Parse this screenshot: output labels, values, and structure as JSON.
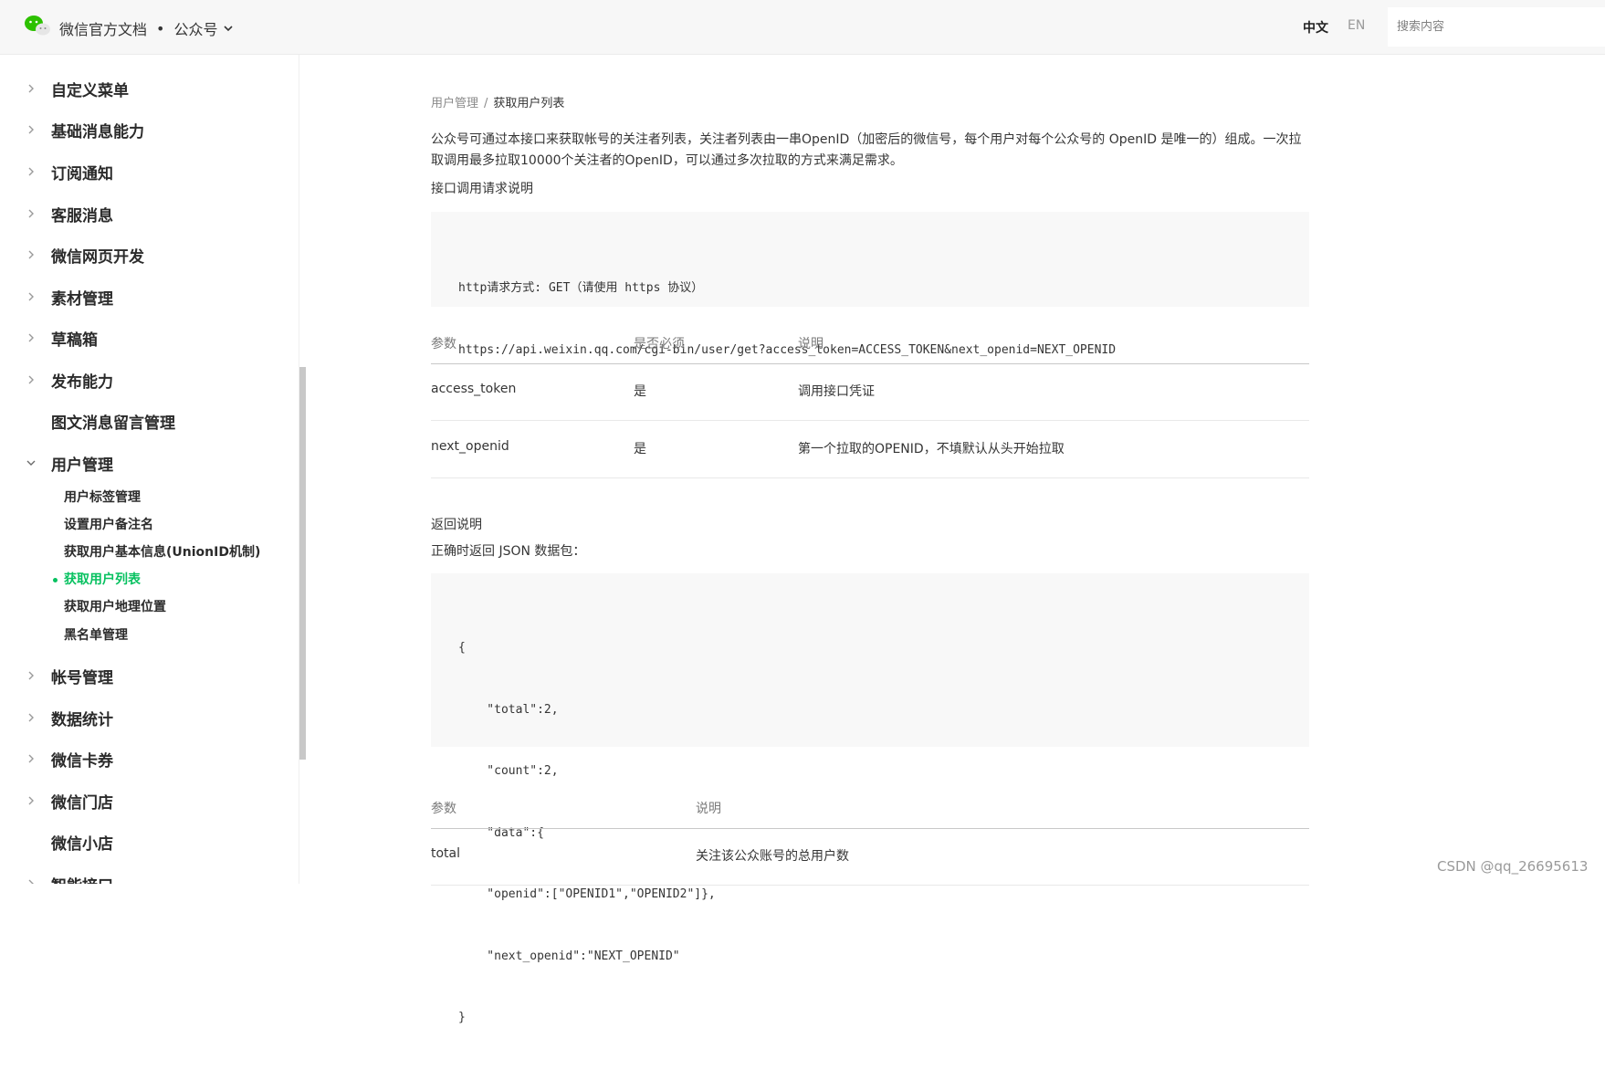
{
  "header": {
    "brand": "微信官方文档",
    "product": "公众号",
    "lang_zh": "中文",
    "lang_en": "EN",
    "search_placeholder": "搜索内容"
  },
  "sidebar": {
    "items": [
      {
        "label": "自定义菜单"
      },
      {
        "label": "基础消息能力"
      },
      {
        "label": "订阅通知"
      },
      {
        "label": "客服消息"
      },
      {
        "label": "微信网页开发"
      },
      {
        "label": "素材管理"
      },
      {
        "label": "草稿箱"
      },
      {
        "label": "发布能力"
      },
      {
        "label": "图文消息留言管理"
      },
      {
        "label": "用户管理"
      },
      {
        "label": "帐号管理"
      },
      {
        "label": "数据统计"
      },
      {
        "label": "微信卡券"
      },
      {
        "label": "微信门店"
      },
      {
        "label": "微信小店"
      },
      {
        "label": "智能接口"
      }
    ],
    "user_sub_items": [
      {
        "label": "用户标签管理"
      },
      {
        "label": "设置用户备注名"
      },
      {
        "label": "获取用户基本信息(UnionID机制)"
      },
      {
        "label": "获取用户列表"
      },
      {
        "label": "获取用户地理位置"
      },
      {
        "label": "黑名单管理"
      }
    ]
  },
  "main": {
    "breadcrumb_parent": "用户管理",
    "breadcrumb_sep": "/",
    "breadcrumb_current": "获取用户列表",
    "intro_line1": "公众号可通过本接口来获取帐号的关注者列表，关注者列表由一串OpenID（加密后的微信号，每个用户对每个公众号的 OpenID 是唯一的）组成。一次拉",
    "intro_line2": "取调用最多拉取10000个关注者的OpenID，可以通过多次拉取的方式来满足需求。",
    "request_title": "接口调用请求说明",
    "request_code": [
      "http请求方式: GET（请使用 https 协议）",
      "https://api.weixin.qq.com/cgi-bin/user/get?access_token=ACCESS_TOKEN&next_openid=NEXT_OPENID"
    ],
    "param_table": {
      "headers": [
        "参数",
        "是否必须",
        "说明"
      ],
      "rows": [
        [
          "access_token",
          "是",
          "调用接口凭证"
        ],
        [
          "next_openid",
          "是",
          "第一个拉取的OPENID，不填默认从头开始拉取"
        ]
      ]
    },
    "return_title": "返回说明",
    "return_subtitle": "正确时返回 JSON 数据包：",
    "return_code": [
      "{",
      "    \"total\":2,",
      "    \"count\":2,",
      "    \"data\":{",
      "    \"openid\":[\"OPENID1\",\"OPENID2\"]},",
      "    \"next_openid\":\"NEXT_OPENID\"",
      "}"
    ],
    "return_table": {
      "headers": [
        "参数",
        "说明"
      ],
      "rows": [
        [
          "total",
          "关注该公众账号的总用户数"
        ]
      ]
    }
  },
  "watermark": "CSDN @qq_26695613",
  "colors": {
    "accent": "#07c160",
    "header_bg": "#f7f7f7",
    "code_bg": "#f8f8f8"
  }
}
